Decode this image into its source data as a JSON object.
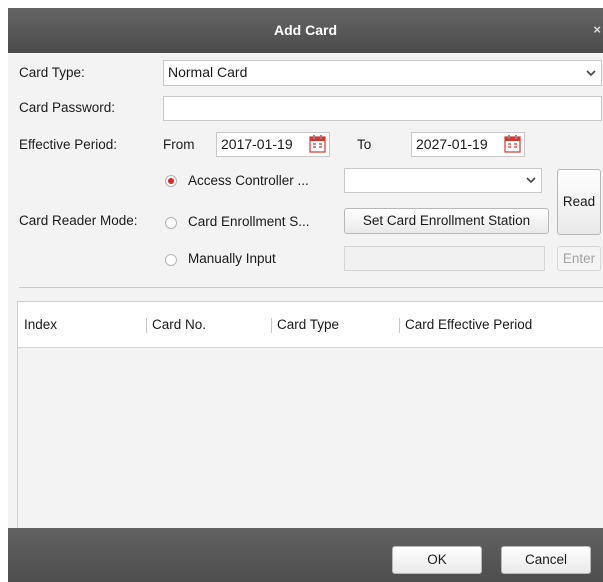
{
  "dialog": {
    "title": "Add Card",
    "close_glyph": "×"
  },
  "form": {
    "card_type": {
      "label": "Card Type:",
      "value": "Normal Card"
    },
    "card_password": {
      "label": "Card Password:",
      "value": ""
    },
    "effective_period": {
      "label": "Effective Period:",
      "from_label": "From",
      "from_date": "2017-01-19",
      "to_label": "To",
      "to_date": "2027-01-19"
    },
    "card_reader_mode": {
      "label": "Card Reader Mode:",
      "options": [
        {
          "label": "Access Controller ...",
          "selected": true
        },
        {
          "label": "Card Enrollment S...",
          "selected": false
        },
        {
          "label": "Manually Input",
          "selected": false
        }
      ],
      "controller_select_value": "",
      "set_station_button": "Set Card Enrollment Station",
      "manual_input_value": "",
      "enter_button": "Enter",
      "read_button": "Read"
    }
  },
  "table": {
    "columns": [
      "Index",
      "Card No.",
      "Card Type",
      "Card Effective Period"
    ],
    "rows": []
  },
  "footer": {
    "ok_button": "OK",
    "cancel_button": "Cancel"
  },
  "colors": {
    "titlebar": "#565656",
    "radio_selected": "#e02424",
    "calendar_icon": "#d9352b"
  },
  "icons": [
    "close-icon",
    "chevron-down-icon",
    "calendar-icon",
    "radio-icon"
  ]
}
